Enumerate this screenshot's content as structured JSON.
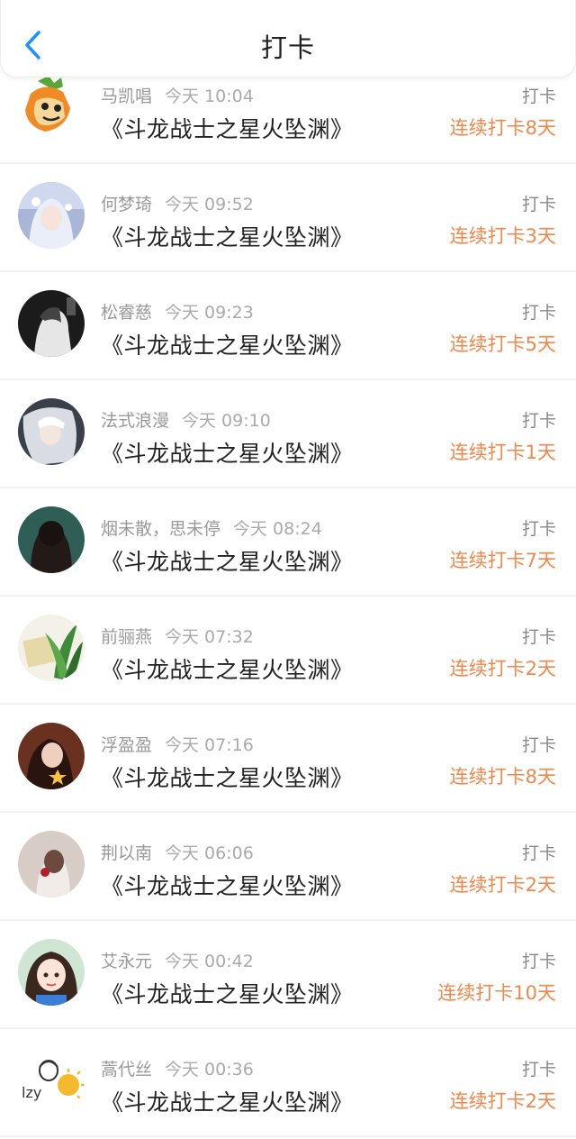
{
  "header": {
    "title": "打卡",
    "back_icon": "chevron-left-icon",
    "accent_color": "#1e90ff"
  },
  "colors": {
    "streak": "#f0884a",
    "name": "#999999",
    "book": "#222222"
  },
  "items": [
    {
      "name": "马凯唱",
      "time": "今天 10:04",
      "book": "《斗龙战士之星火坠渊》",
      "action": "打卡",
      "streak": "连续打卡8天",
      "avatar": "carrot-cartoon-avatar"
    },
    {
      "name": "何梦琦",
      "time": "今天 09:52",
      "book": "《斗龙战士之星火坠渊》",
      "action": "打卡",
      "streak": "连续打卡3天",
      "avatar": "anime-girl-avatar"
    },
    {
      "name": "松睿慈",
      "time": "今天 09:23",
      "book": "《斗龙战士之星火坠渊》",
      "action": "打卡",
      "streak": "连续打卡5天",
      "avatar": "black-white-photo-avatar"
    },
    {
      "name": "法式浪漫",
      "time": "今天 09:10",
      "book": "《斗龙战士之星火坠渊》",
      "action": "打卡",
      "streak": "连续打卡1天",
      "avatar": "anime-boy-avatar"
    },
    {
      "name": "烟未散，思未停",
      "time": "今天 08:24",
      "book": "《斗龙战士之星火坠渊》",
      "action": "打卡",
      "streak": "连续打卡7天",
      "avatar": "girl-back-avatar"
    },
    {
      "name": "前骊燕",
      "time": "今天 07:32",
      "book": "《斗龙战士之星火坠渊》",
      "action": "打卡",
      "streak": "连续打卡2天",
      "avatar": "plant-photo-avatar"
    },
    {
      "name": "浮盈盈",
      "time": "今天 07:16",
      "book": "《斗龙战士之星火坠渊》",
      "action": "打卡",
      "streak": "连续打卡8天",
      "avatar": "girl-star-avatar"
    },
    {
      "name": "荆以南",
      "time": "今天 06:06",
      "book": "《斗龙战士之星火坠渊》",
      "action": "打卡",
      "streak": "连续打卡2天",
      "avatar": "girl-flower-avatar"
    },
    {
      "name": "艾永元",
      "time": "今天 00:42",
      "book": "《斗龙战士之星火坠渊》",
      "action": "打卡",
      "streak": "连续打卡10天",
      "avatar": "cartoon-girl-avatar"
    },
    {
      "name": "蒿代丝",
      "time": "今天 00:36",
      "book": "《斗龙战士之星火坠渊》",
      "action": "打卡",
      "streak": "连续打卡2天",
      "avatar": "lzy-sketch-avatar"
    }
  ]
}
